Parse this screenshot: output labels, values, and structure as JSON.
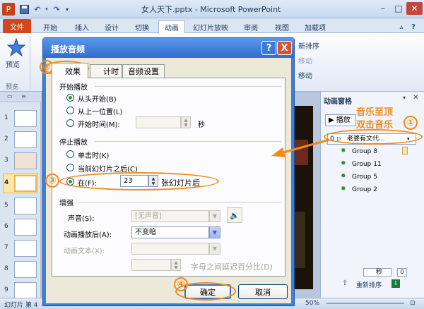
{
  "window": {
    "title": "女人天下.pptx - Microsoft PowerPoint",
    "app_icon": "P"
  },
  "ribbon_tabs": [
    "文件",
    "开始",
    "插入",
    "设计",
    "切换",
    "动画",
    "幻灯片放映",
    "审阅",
    "视图",
    "加载项"
  ],
  "ribbon": {
    "preview_label": "预览",
    "preview_group": "预览",
    "right_items": [
      "新排序",
      "移动",
      "移动"
    ]
  },
  "slides": {
    "numbers": [
      "1",
      "2",
      "3",
      "4",
      "5",
      "6",
      "7",
      "8",
      "9"
    ],
    "selected": "4"
  },
  "anim_pane": {
    "title": "动画窗格",
    "play_label": "播放",
    "items": [
      {
        "index": "0",
        "name": "老婆有文代..."
      },
      {
        "name": "Group 8"
      },
      {
        "name": "Group 11"
      },
      {
        "name": "Group 5"
      },
      {
        "name": "Group 2"
      }
    ],
    "seconds_label": "秒",
    "seconds_value": "0",
    "reorder_label": "重新排序"
  },
  "status": {
    "slide_text": "幻灯片 第 4",
    "zoom": "50%"
  },
  "dialog": {
    "title": "播放音频",
    "help": "?",
    "close": "X",
    "tabs": [
      "效果",
      "计时",
      "音频设置"
    ],
    "start_group": "开始播放",
    "start_options": [
      "从头开始(B)",
      "从上一位置(L)",
      "开始时间(M):"
    ],
    "time_unit": "秒",
    "stop_group": "停止播放",
    "stop_options": [
      "单击时(K)",
      "当前幻灯片之后(C)",
      "在(F):"
    ],
    "stop_after_value": "23",
    "stop_after_suffix": "张幻灯片后",
    "enhance_group": "增强",
    "sound_label": "声音(S):",
    "sound_value": "[无声音]",
    "after_anim_label": "动画播放后(A):",
    "after_anim_value": "不变暗",
    "anim_text_label": "动画文本(X):",
    "letter_delay_label": "字母之间延迟百分比(D)",
    "ok": "确定",
    "cancel": "取消"
  },
  "annotations": {
    "c1": "①",
    "c2": "②",
    "c3": "③",
    "c4": "④",
    "note_line1": "音乐至顶",
    "note_line2": "双击音乐",
    "color": "#f08a1c"
  }
}
